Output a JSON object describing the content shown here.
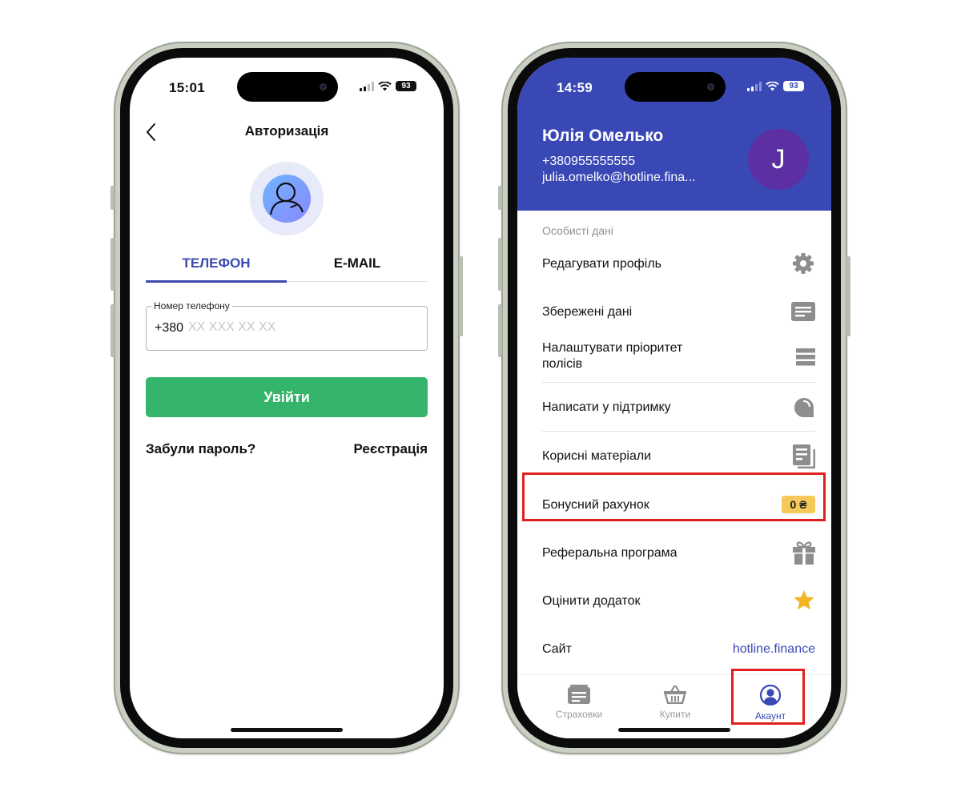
{
  "left_phone": {
    "status": {
      "time": "15:01",
      "battery": "93"
    },
    "header": {
      "title": "Авторизація"
    },
    "tabs": [
      {
        "label": "ТЕЛЕФОН",
        "active": true
      },
      {
        "label": "E-MAIL",
        "active": false
      }
    ],
    "phone_field": {
      "label": "Номер телефону",
      "prefix": "+380",
      "placeholder": "XX XXX XX XX",
      "value": ""
    },
    "login_button": "Увійти",
    "forgot_password": "Забули пароль?",
    "register": "Реєстрація",
    "colors": {
      "primary": "#3b4bb0",
      "button": "#35b46c"
    }
  },
  "right_phone": {
    "status": {
      "time": "14:59",
      "battery": "93"
    },
    "profile": {
      "name": "Юлія Омелько",
      "phone": "+380955555555",
      "email": "julia.omelko@hotline.fina...",
      "avatar_letter": "J"
    },
    "section_label": "Особисті дані",
    "menu": [
      {
        "label": "Редагувати профіль",
        "icon": "gear-icon"
      },
      {
        "label": "Збережені дані",
        "icon": "saved-data-icon"
      },
      {
        "label_line1": "Налаштувати пріоритет",
        "label_line2": "полісів",
        "icon": "priority-list-icon"
      },
      {
        "label": "Написати у підтримку",
        "icon": "chat-icon"
      },
      {
        "label": "Корисні матеріали",
        "icon": "documents-icon"
      },
      {
        "label": "Бонусний рахунок",
        "badge": "0 ₴"
      },
      {
        "label": "Реферальна програма",
        "icon": "gift-icon"
      },
      {
        "label": "Оцінити додаток",
        "icon": "star-icon"
      },
      {
        "label": "Сайт",
        "link": "hotline.finance"
      }
    ],
    "tabbar": [
      {
        "label": "Страховки",
        "icon": "policy-card-icon",
        "active": false
      },
      {
        "label": "Купити",
        "icon": "basket-icon",
        "active": false
      },
      {
        "label": "Акаунт",
        "icon": "account-icon",
        "active": true
      }
    ],
    "colors": {
      "header": "#3a48b5",
      "avatar": "#5c2fa2",
      "badge": "#f4c95a",
      "highlight": "#e01f1f"
    }
  }
}
